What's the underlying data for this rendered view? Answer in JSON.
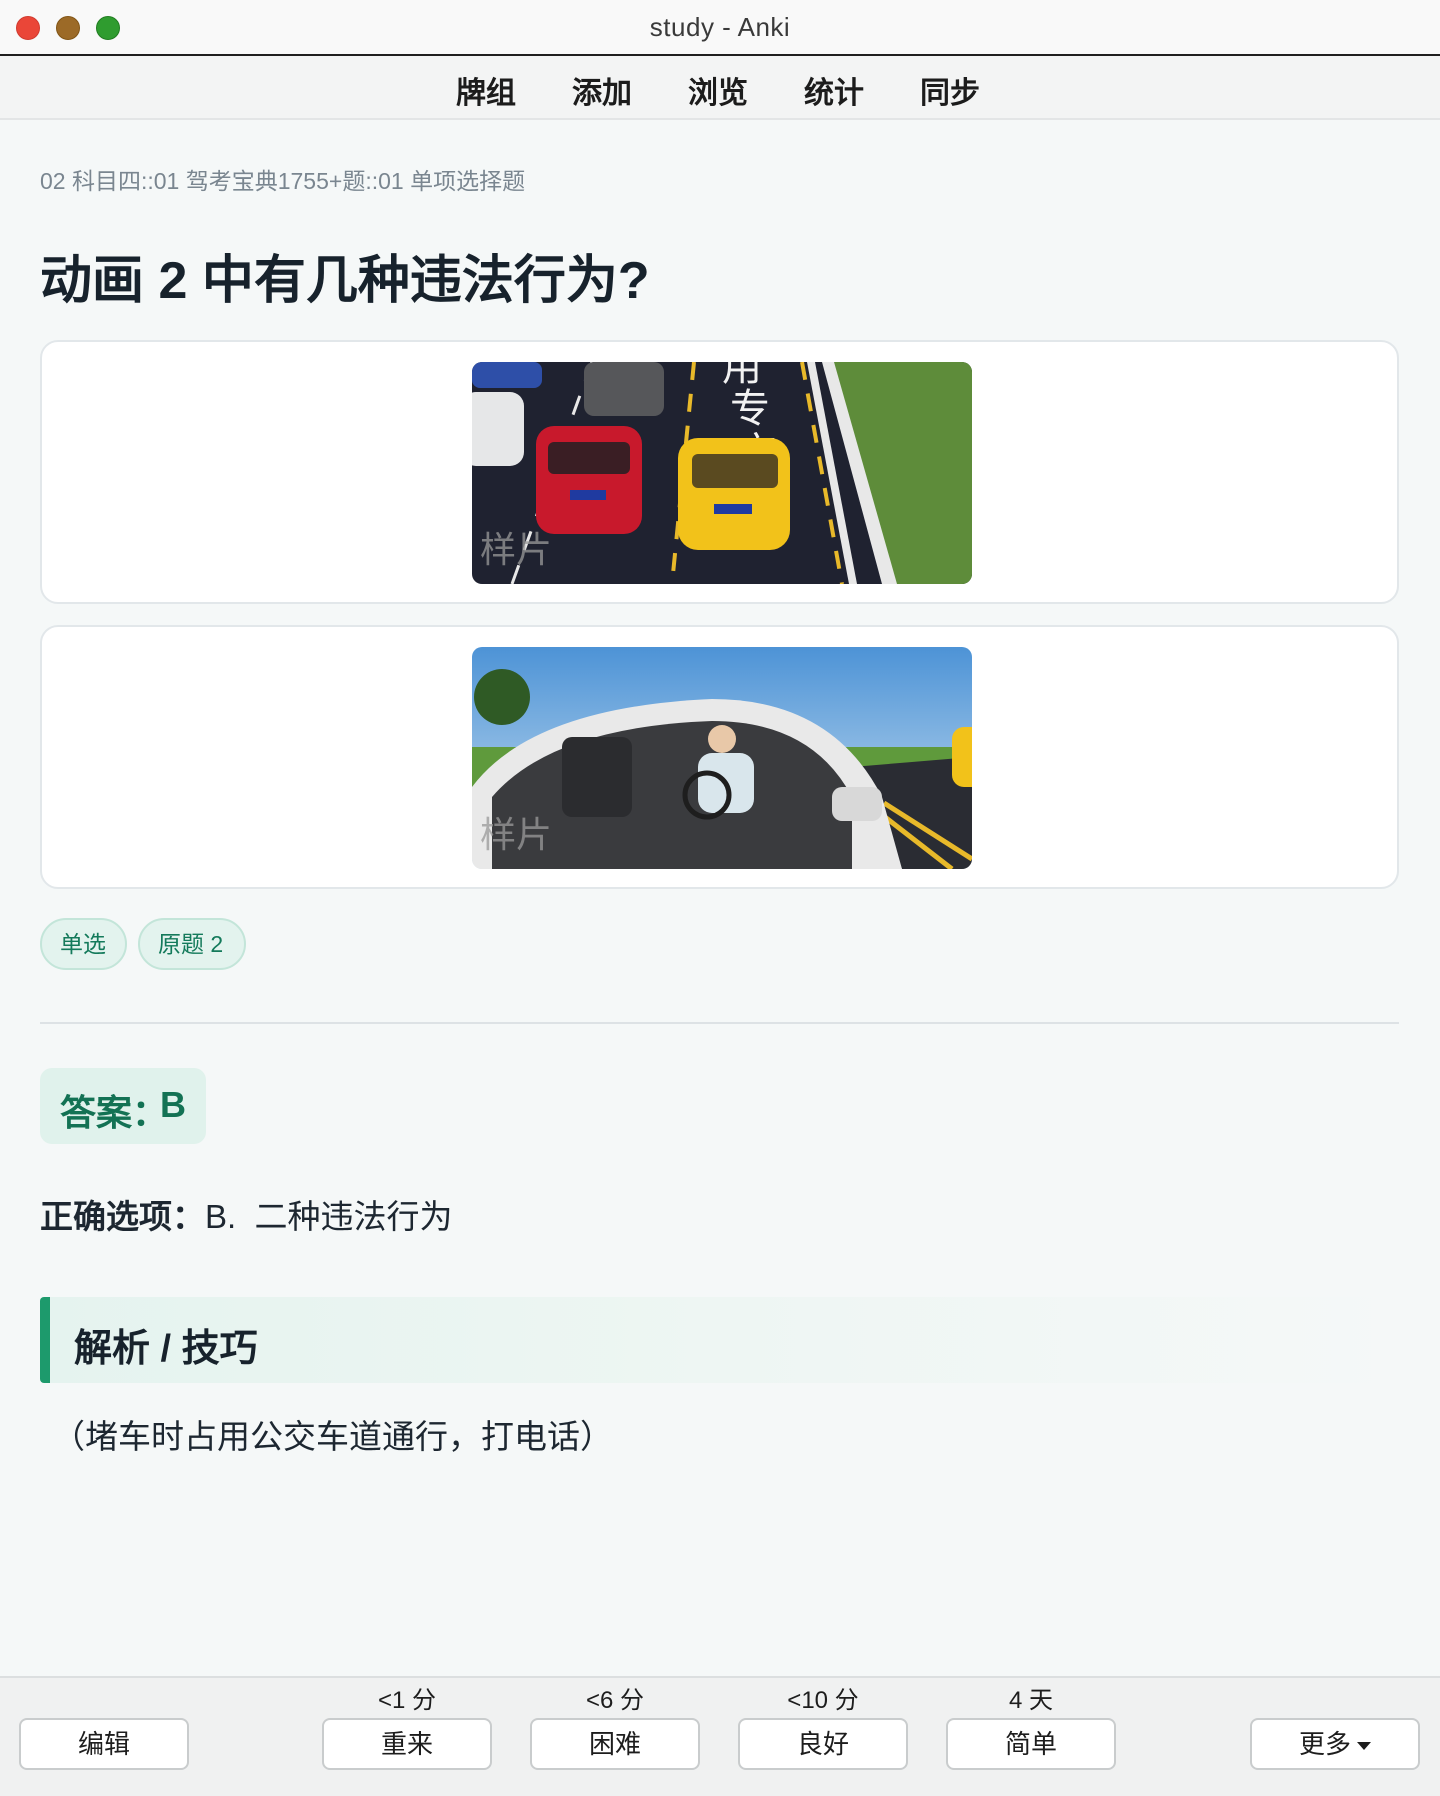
{
  "window": {
    "title": "study - Anki"
  },
  "toolbar": {
    "items": [
      "牌组",
      "添加",
      "浏览",
      "统计",
      "同步"
    ]
  },
  "card": {
    "breadcrumb": "02 科目四::01 驾考宝典1755+题::01 单项选择题",
    "question": "动画 2 中有几种违法行为?",
    "images": [
      {
        "watermark": "样片"
      },
      {
        "watermark": "样片"
      }
    ],
    "tags": [
      "单选",
      "原题 2"
    ],
    "answer_label": "答案：",
    "answer_letter": "B",
    "correct_label": "正确选项：",
    "correct_value": "B.  二种违法行为",
    "analysis_title": "解析 / 技巧",
    "analysis_text": "（堵车时占用公交车道通行，打电话）"
  },
  "bottom": {
    "edit": "编辑",
    "more": "更多",
    "answers": [
      {
        "time": "<1 分",
        "label": "重来"
      },
      {
        "time": "<6 分",
        "label": "困难"
      },
      {
        "time": "<10 分",
        "label": "良好"
      },
      {
        "time": "4 天",
        "label": "简单"
      }
    ]
  }
}
